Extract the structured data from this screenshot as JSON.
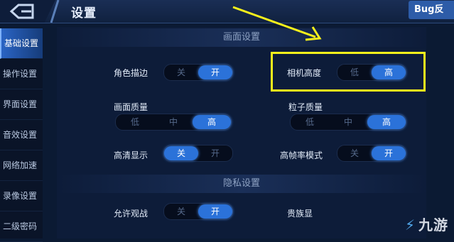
{
  "header": {
    "title": "设置",
    "bug_button": "Bug反"
  },
  "sidebar": {
    "items": [
      {
        "label": "基础设置",
        "active": true
      },
      {
        "label": "操作设置",
        "active": false
      },
      {
        "label": "界面设置",
        "active": false
      },
      {
        "label": "音效设置",
        "active": false
      },
      {
        "label": "网络加速",
        "active": false
      },
      {
        "label": "录像设置",
        "active": false
      },
      {
        "label": "二级密码",
        "active": false
      }
    ]
  },
  "sections": {
    "graphics": "画面设置",
    "privacy": "隐私设置"
  },
  "settings": {
    "outline": {
      "label": "角色描边",
      "options": [
        "关",
        "开"
      ],
      "selected": "开"
    },
    "camera": {
      "label": "相机高度",
      "options": [
        "低",
        "高"
      ],
      "selected": "高"
    },
    "quality": {
      "label": "画面质量",
      "options": [
        "低",
        "中",
        "高"
      ],
      "selected": "高"
    },
    "particle": {
      "label": "粒子质量",
      "options": [
        "低",
        "中",
        "高"
      ],
      "selected": "高"
    },
    "hd": {
      "label": "高清显示",
      "options": [
        "关",
        "开"
      ],
      "selected": "关"
    },
    "highfps": {
      "label": "高帧率模式",
      "options": [
        "关",
        "开"
      ],
      "selected": "开"
    },
    "spectate": {
      "label": "允许观战",
      "options": [
        "关",
        "开"
      ],
      "selected": "开"
    },
    "noble": {
      "label": "贵族显"
    }
  },
  "watermark": "九游",
  "colors": {
    "accent": "#2b72d9",
    "highlight": "#f7f11b",
    "annotation_arrow": "#f7f11b"
  }
}
